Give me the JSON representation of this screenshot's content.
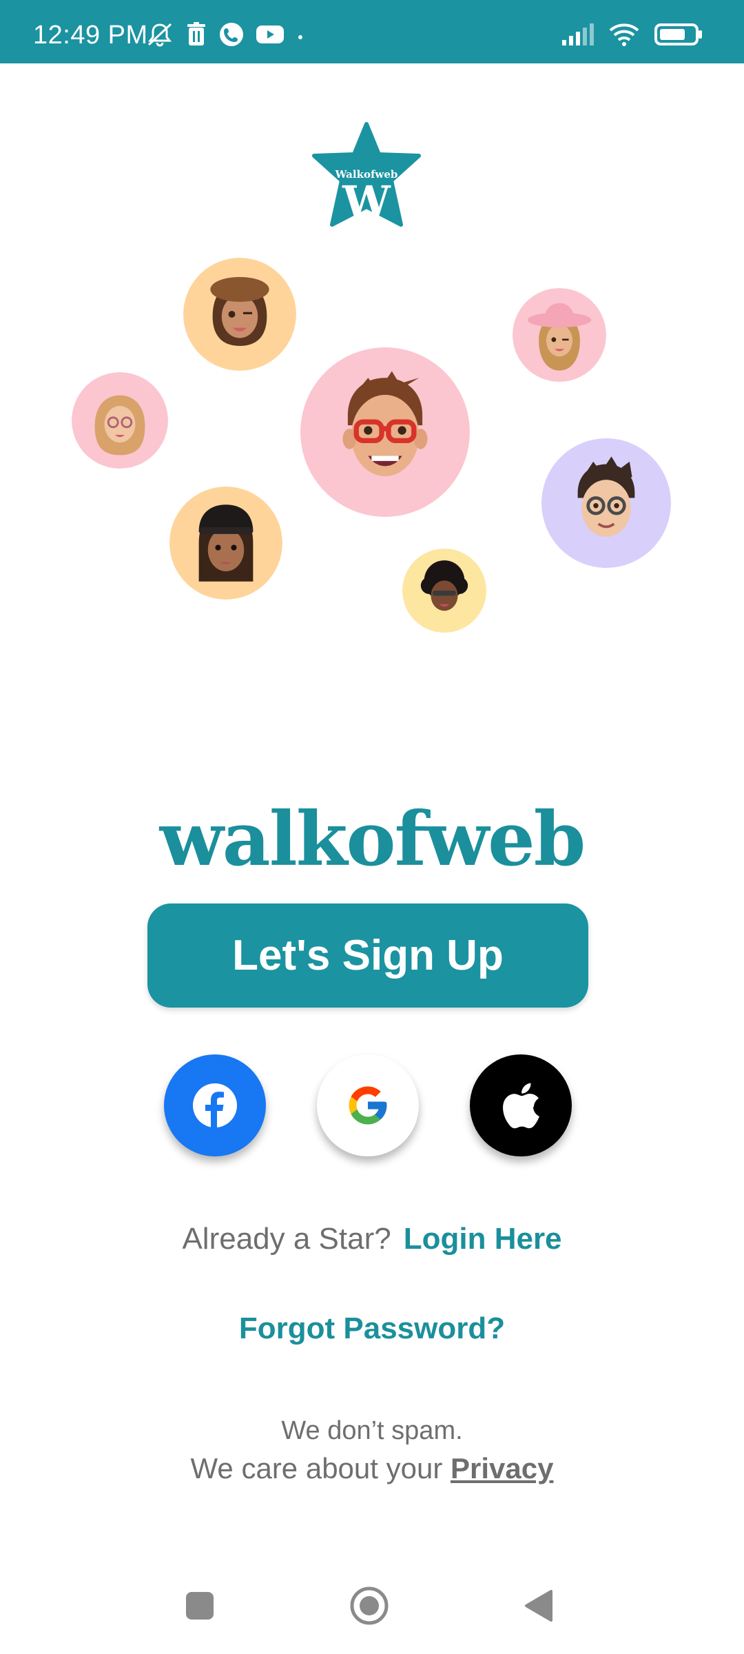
{
  "status_bar": {
    "time": "12:49 PM",
    "left_icons": [
      "muted-bell-icon",
      "trash-icon",
      "phone-icon",
      "youtube-icon",
      "dot-icon"
    ],
    "right_icons": [
      "signal-icon",
      "wifi-icon",
      "battery-icon"
    ]
  },
  "logo": {
    "text": "Walkofweb",
    "letter": "W"
  },
  "avatars": [
    "avatar-beret-girl",
    "avatar-cowgirl",
    "avatar-blonde-girl",
    "avatar-glasses-boy",
    "avatar-round-glasses-boy",
    "avatar-beanie-girl",
    "avatar-curly-hair"
  ],
  "brand": "walkofweb",
  "signup": {
    "label": "Let's Sign Up"
  },
  "social": [
    "facebook-icon",
    "google-icon",
    "apple-icon"
  ],
  "login": {
    "prompt": "Already a Star?",
    "link": "Login Here"
  },
  "forgot_password": "Forgot Password?",
  "privacy": {
    "line1": "We don’t spam.",
    "line2_prefix": "We care about your ",
    "link": "Privacy"
  },
  "colors": {
    "accent": "#1b93a1",
    "text_gray": "#6e6e6e",
    "facebook": "#1877f2"
  }
}
